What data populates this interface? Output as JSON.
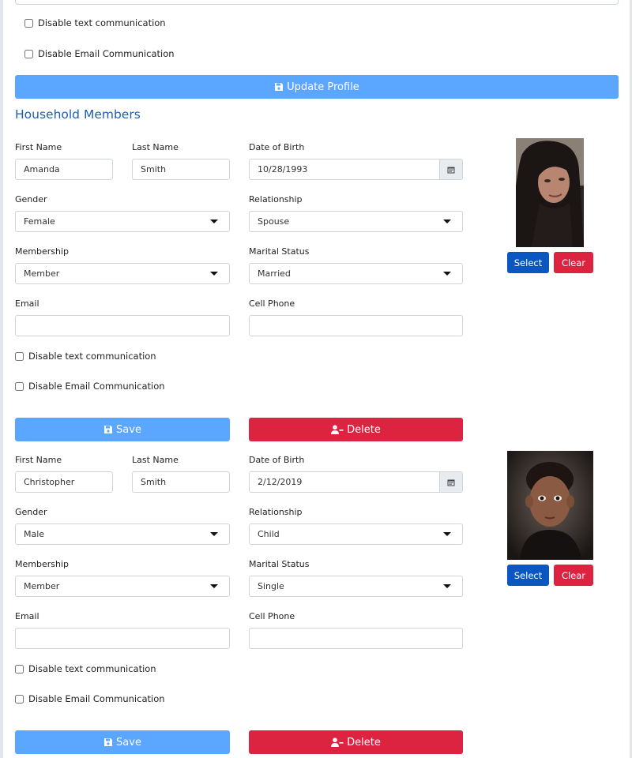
{
  "profile": {
    "disable_text_label": "Disable text communication",
    "disable_email_label": "Disable Email Communication",
    "update_button_label": "Update Profile"
  },
  "household": {
    "title": "Household Members",
    "labels": {
      "first_name": "First Name",
      "last_name": "Last Name",
      "dob": "Date of Birth",
      "gender": "Gender",
      "relationship": "Relationship",
      "membership": "Membership",
      "marital_status": "Marital Status",
      "email": "Email",
      "cell_phone": "Cell Phone",
      "disable_text": "Disable text communication",
      "disable_email": "Disable Email Communication",
      "save": "Save",
      "delete": "Delete",
      "select": "Select",
      "clear": "Clear"
    },
    "members": [
      {
        "first_name": "Amanda",
        "last_name": "Smith",
        "dob": "10/28/1993",
        "gender": "Female",
        "relationship": "Spouse",
        "membership": "Member",
        "marital_status": "Married",
        "email": "",
        "cell_phone": ""
      },
      {
        "first_name": "Christopher",
        "last_name": "Smith",
        "dob": "2/12/2019",
        "gender": "Male",
        "relationship": "Child",
        "membership": "Member",
        "marital_status": "Single",
        "email": "",
        "cell_phone": ""
      }
    ]
  },
  "icons": {
    "save": "floppy-disk-icon",
    "delete": "user-minus-icon",
    "calendar": "calendar-icon",
    "dropdown": "caret-down-icon"
  },
  "colors": {
    "primary_light": "#5ba6ff",
    "primary_dark": "#0b57c2",
    "danger": "#dc2440",
    "heading": "#1d5fb5"
  }
}
